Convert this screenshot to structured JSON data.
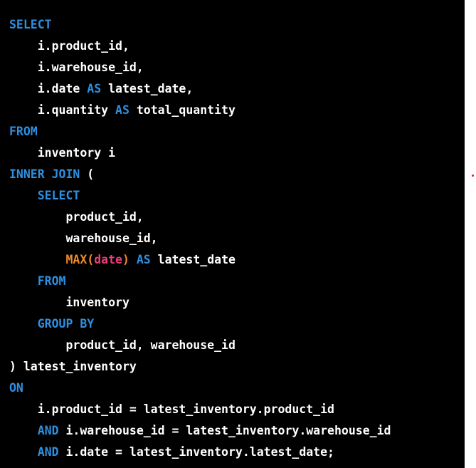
{
  "editor": {
    "lines": [
      [
        {
          "t": "SELECT",
          "k": "kw"
        }
      ],
      [
        {
          "t": "    i.product_id,",
          "k": "plain"
        }
      ],
      [
        {
          "t": "    i.warehouse_id,",
          "k": "plain"
        }
      ],
      [
        {
          "t": "    i.date ",
          "k": "plain"
        },
        {
          "t": "AS",
          "k": "kw"
        },
        {
          "t": " latest_date,",
          "k": "plain"
        }
      ],
      [
        {
          "t": "    i.quantity ",
          "k": "plain"
        },
        {
          "t": "AS",
          "k": "kw"
        },
        {
          "t": " total_quantity",
          "k": "plain"
        }
      ],
      [
        {
          "t": "FROM",
          "k": "kw"
        }
      ],
      [
        {
          "t": "    inventory i",
          "k": "plain"
        }
      ],
      [
        {
          "t": "INNER JOIN",
          "k": "kw"
        },
        {
          "t": " (",
          "k": "plain"
        }
      ],
      [
        {
          "t": "    ",
          "k": "plain"
        },
        {
          "t": "SELECT",
          "k": "kw"
        }
      ],
      [
        {
          "t": "        product_id,",
          "k": "plain"
        }
      ],
      [
        {
          "t": "        warehouse_id,",
          "k": "plain"
        }
      ],
      [
        {
          "t": "        ",
          "k": "plain"
        },
        {
          "t": "MAX",
          "k": "fn"
        },
        {
          "t": "(",
          "k": "fn"
        },
        {
          "t": "date",
          "k": "arg"
        },
        {
          "t": ")",
          "k": "fn"
        },
        {
          "t": " ",
          "k": "plain"
        },
        {
          "t": "AS",
          "k": "kw"
        },
        {
          "t": " latest_date",
          "k": "plain"
        }
      ],
      [
        {
          "t": "    ",
          "k": "plain"
        },
        {
          "t": "FROM",
          "k": "kw"
        }
      ],
      [
        {
          "t": "        inventory",
          "k": "plain"
        }
      ],
      [
        {
          "t": "    ",
          "k": "plain"
        },
        {
          "t": "GROUP BY",
          "k": "kw"
        }
      ],
      [
        {
          "t": "        product_id, warehouse_id",
          "k": "plain"
        }
      ],
      [
        {
          "t": ") latest_inventory",
          "k": "plain"
        }
      ],
      [
        {
          "t": "ON",
          "k": "kw"
        }
      ],
      [
        {
          "t": "    i.product_id = latest_inventory.product_id",
          "k": "plain"
        }
      ],
      [
        {
          "t": "    ",
          "k": "plain"
        },
        {
          "t": "AND",
          "k": "kw"
        },
        {
          "t": " i.warehouse_id = latest_inventory.warehouse_id",
          "k": "plain"
        }
      ],
      [
        {
          "t": "    ",
          "k": "plain"
        },
        {
          "t": "AND",
          "k": "kw"
        },
        {
          "t": " i.date = latest_inventory.latest_date;",
          "k": "plain"
        }
      ]
    ]
  },
  "colors": {
    "background": "#000000",
    "keyword": "#2f8fe0",
    "function": "#ee8a2a",
    "argument": "#e83e7a",
    "text": "#ffffff",
    "marker": "#d81e2a"
  }
}
